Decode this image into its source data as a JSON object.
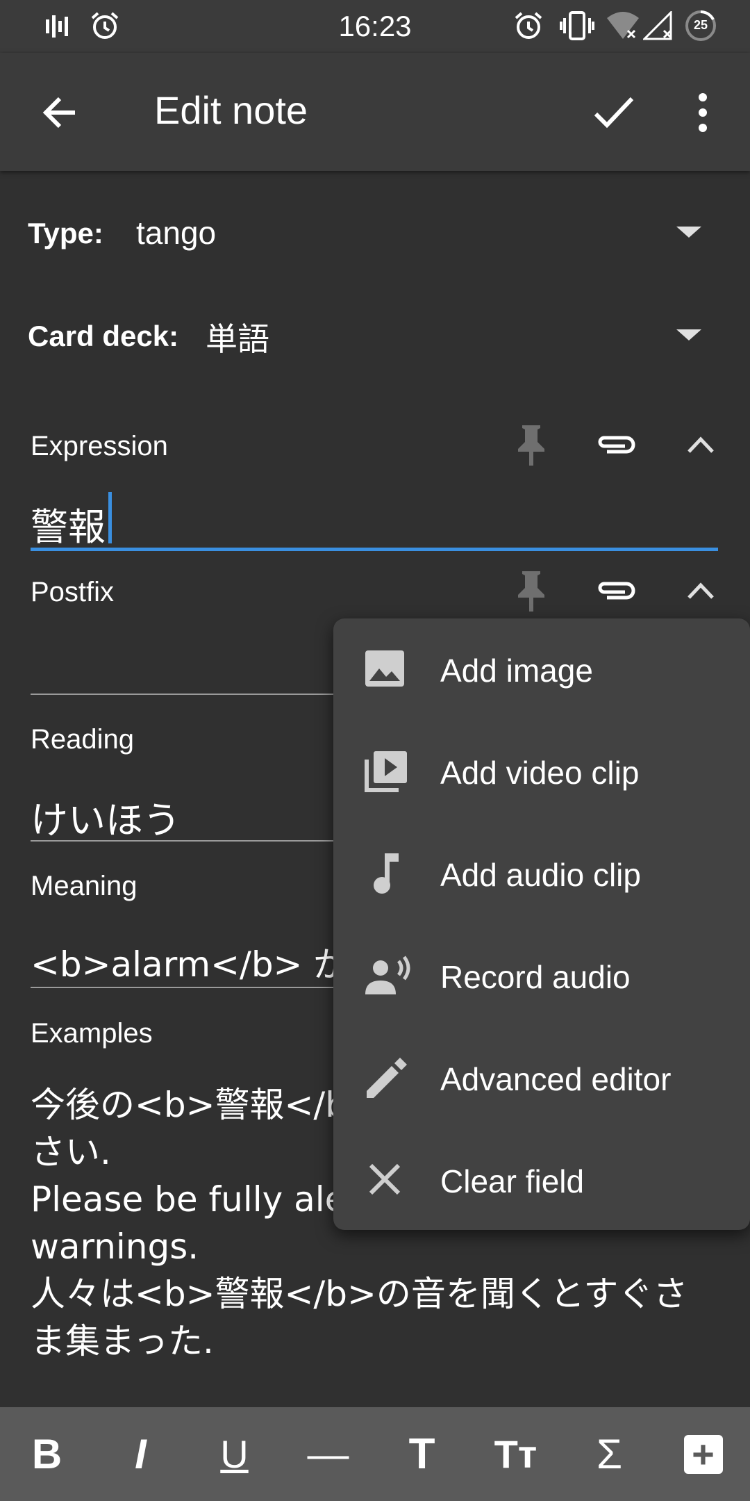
{
  "status_bar": {
    "time": "16:23",
    "battery": "25"
  },
  "app_bar": {
    "title": "Edit note"
  },
  "type_row": {
    "label": "Type:",
    "value": "tango"
  },
  "deck_row": {
    "label": "Card deck:",
    "value": "単語"
  },
  "fields": [
    {
      "label": "Expression",
      "value": "警報"
    },
    {
      "label": "Postfix",
      "value": ""
    },
    {
      "label": "Reading",
      "value": "けいほう"
    },
    {
      "label": "Meaning",
      "value": "<b>alarm</b> が鳴"
    },
    {
      "label": "Examples",
      "lines": [
        "今後の<b>警報</b",
        "さい.",
        "Please be fully ale",
        "warnings.",
        "人々は<b>警報</b>の音を聞くとすぐさ",
        "ま集まった."
      ]
    }
  ],
  "menu": {
    "items": [
      {
        "label": "Add image",
        "icon": "image-icon"
      },
      {
        "label": "Add video clip",
        "icon": "video-library-icon"
      },
      {
        "label": "Add audio clip",
        "icon": "music-note-icon"
      },
      {
        "label": "Record audio",
        "icon": "record-voice-icon"
      },
      {
        "label": "Advanced editor",
        "icon": "pencil-icon"
      },
      {
        "label": "Clear field",
        "icon": "close-icon"
      }
    ]
  },
  "toolbar": {
    "buttons": [
      {
        "label": "B",
        "icon": "bold-icon"
      },
      {
        "label": "I",
        "icon": "italic-icon"
      },
      {
        "label": "U",
        "icon": "underline-icon"
      },
      {
        "label": "—",
        "icon": "horizontal-rule-icon"
      },
      {
        "label": "T",
        "icon": "title-icon"
      },
      {
        "label": "Tт",
        "icon": "font-size-icon"
      },
      {
        "label": "Σ",
        "icon": "mathjax-icon"
      },
      {
        "label": "+",
        "icon": "add-box-icon"
      }
    ]
  }
}
